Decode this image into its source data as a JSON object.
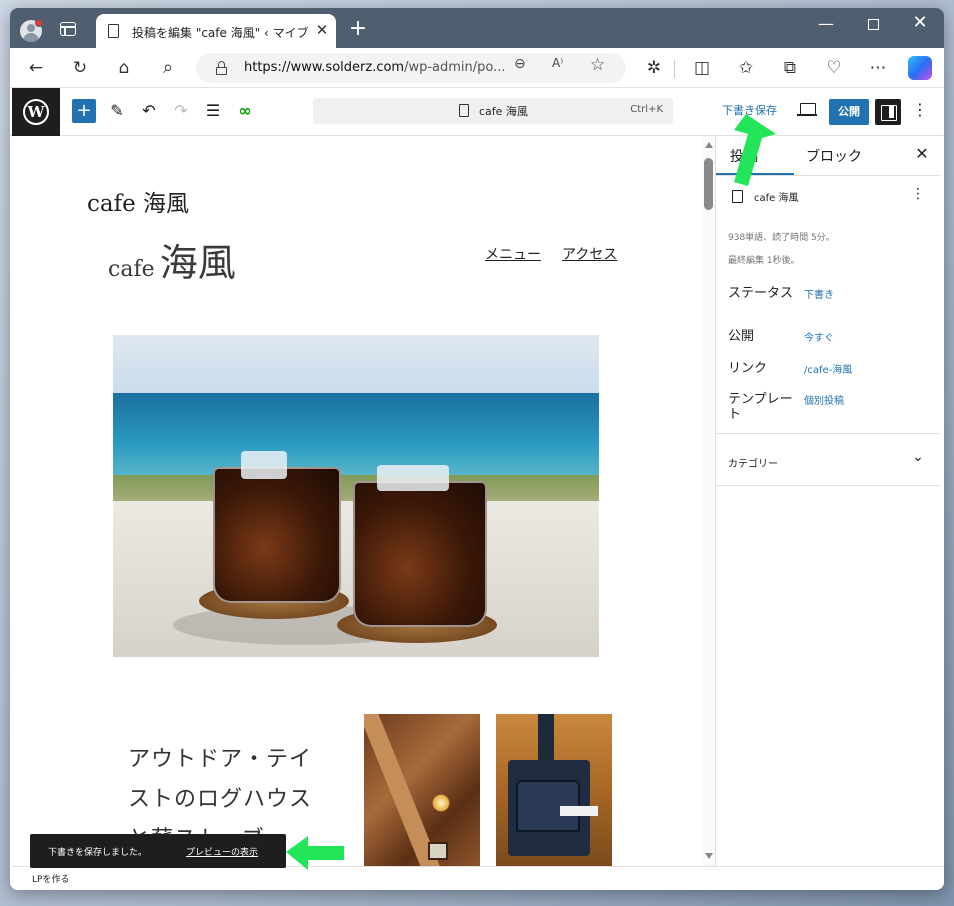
{
  "browser": {
    "tab_title": "投稿を編集 \"cafe 海風\" ‹ マイブログ",
    "url_host": "https://www.solderz.com",
    "url_path": "/wp-admin/po...",
    "new_tab": "+",
    "tab_close": "✕",
    "win_minimize": "—",
    "win_close": "✕",
    "icons": [
      "profile-icon",
      "tab-actions-icon",
      "back-icon",
      "refresh-icon",
      "home-icon",
      "search-icon",
      "lock-icon",
      "zoom-icon",
      "read-aloud-icon",
      "favorite-icon",
      "extensions-icon",
      "split-screen-icon",
      "favorites-icon",
      "collections-icon",
      "performance-icon",
      "more-icon",
      "copilot-icon"
    ],
    "toolbar_glyphs": {
      "back": "←",
      "refresh": "↻",
      "home": "⌂",
      "search": "⌕",
      "zoom": "⊖",
      "read": "A⁾",
      "favorite": "☆",
      "extensions": "✲",
      "split": "◫",
      "favorites": "✩",
      "collections": "⧉",
      "performance": "♡",
      "more": "⋯"
    }
  },
  "wp_toolbar": {
    "add": "+",
    "tool_glyphs": {
      "edit": "✎",
      "undo": "↶",
      "redo": "↷",
      "outline": "☰",
      "jetpack": "∞"
    },
    "command_title": "cafe 海風",
    "command_shortcut": "Ctrl+K",
    "save_draft": "下書き保存",
    "publish": "公開",
    "options": "⋮",
    "colors": {
      "accent": "#2271b1",
      "dark": "#1e1e1e"
    }
  },
  "canvas": {
    "site_title_small": "cafe 海風",
    "site_title_large_latin": "cafe",
    "site_title_large_kanji": "海風",
    "nav": [
      "メニュー",
      "アクセス"
    ],
    "text_block": "アウトドア・テイストのログハウスと薪ストーブ"
  },
  "sidebar": {
    "tab_post": "投稿",
    "tab_block": "ブロック",
    "close": "✕",
    "doc_title": "cafe 海風",
    "doc_menu": "⋮",
    "words": "938単語、読了時間 5分。",
    "edited": "最終編集 1秒後。",
    "rows": [
      {
        "label": "ステータス",
        "value": "下書き"
      },
      {
        "label": "公開",
        "value": "今すぐ"
      },
      {
        "label": "リンク",
        "value": "/cafe-海風"
      },
      {
        "label": "テンプレート",
        "value": "個別投稿"
      }
    ],
    "category": "カテゴリー",
    "category_chevron": "⌄"
  },
  "footer": {
    "breadcrumb": "LPを作る"
  },
  "snackbar": {
    "message": "下書きを保存しました。",
    "link": "プレビューの表示"
  },
  "annotation_color": "#22e55a"
}
